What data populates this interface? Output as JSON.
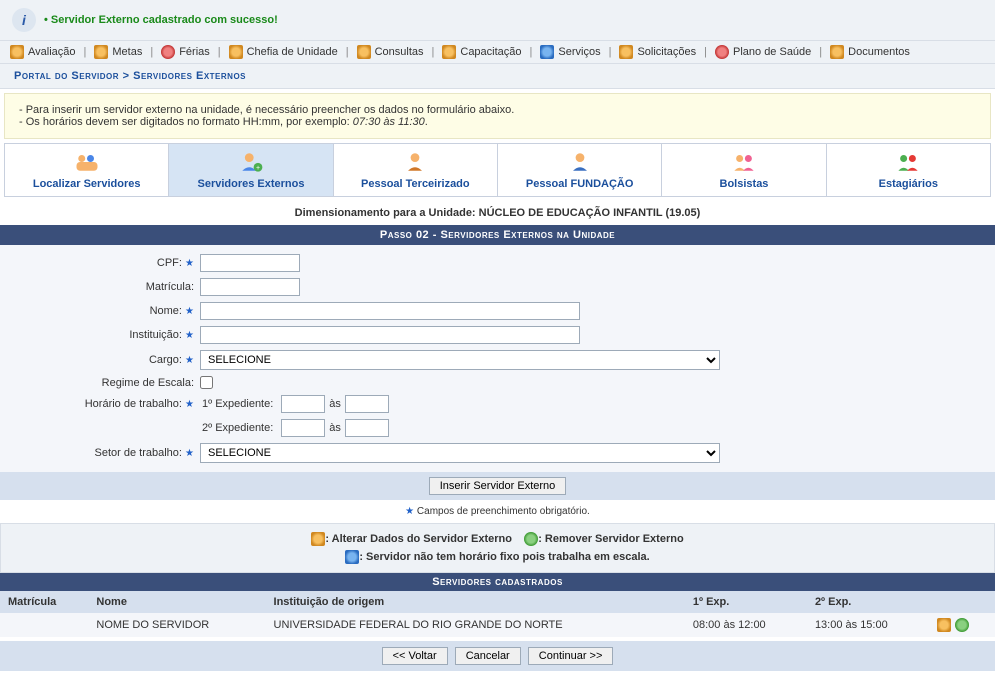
{
  "info": {
    "success_message": "Servidor Externo cadastrado com sucesso!"
  },
  "menu": {
    "items": [
      {
        "label": "Avaliação",
        "icon": "clipboard-icon"
      },
      {
        "label": "Metas",
        "icon": "target-icon"
      },
      {
        "label": "Férias",
        "icon": "sun-icon"
      },
      {
        "label": "Chefia de Unidade",
        "icon": "unit-icon"
      },
      {
        "label": "Consultas",
        "icon": "search-icon"
      },
      {
        "label": "Capacitação",
        "icon": "training-icon"
      },
      {
        "label": "Serviços",
        "icon": "user-icon"
      },
      {
        "label": "Solicitações",
        "icon": "request-icon"
      },
      {
        "label": "Plano de Saúde",
        "icon": "health-icon"
      },
      {
        "label": "Documentos",
        "icon": "documents-icon"
      }
    ]
  },
  "breadcrumb": {
    "portal": "Portal do Servidor",
    "sep": ">",
    "page": "Servidores Externos"
  },
  "tips": {
    "line1": "- Para inserir um servidor externo na unidade, é necessário preencher os dados no formulário abaixo.",
    "line2_a": "- Os horários devem ser digitados no formato HH:mm, por exemplo: ",
    "line2_b": "07:30 às 11:30",
    "line2_c": "."
  },
  "tabs": [
    {
      "label": "Localizar Servidores",
      "active": false
    },
    {
      "label": "Servidores Externos",
      "active": true
    },
    {
      "label": "Pessoal Terceirizado",
      "active": false
    },
    {
      "label": "Pessoal FUNDAÇÃO",
      "active": false
    },
    {
      "label": "Bolsistas",
      "active": false
    },
    {
      "label": "Estagiários",
      "active": false
    }
  ],
  "dimension": {
    "prefix": "Dimensionamento para a Unidade: ",
    "unit": "NÚCLEO DE EDUCAÇÃO INFANTIL (19.05)"
  },
  "section": {
    "title": "Passo 02 - Servidores Externos na Unidade"
  },
  "form": {
    "cpf_label": "CPF:",
    "matricula_label": "Matrícula:",
    "nome_label": "Nome:",
    "instituicao_label": "Instituição:",
    "cargo_label": "Cargo:",
    "cargo_selected": "SELECIONE",
    "regime_label": "Regime de Escala:",
    "horario_label": "Horário de trabalho:",
    "exp1_label": "1º Expediente:",
    "exp2_label": "2º Expediente:",
    "as_label": "às",
    "setor_label": "Setor de trabalho:",
    "setor_selected": "SELECIONE",
    "submit_label": "Inserir Servidor Externo",
    "required_note": "Campos de preenchimento obrigatório."
  },
  "legend": {
    "edit": ": Alterar Dados do Servidor Externo",
    "remove": ": Remover Servidor Externo",
    "scale": ": Servidor não tem horário fixo pois trabalha em escala."
  },
  "registered": {
    "title": "Servidores cadastrados"
  },
  "table": {
    "headers": {
      "matricula": "Matrícula",
      "nome": "Nome",
      "instituicao": "Instituição de origem",
      "exp1": "1º Exp.",
      "exp2": "2º Exp."
    },
    "rows": [
      {
        "matricula": "",
        "nome": "NOME DO SERVIDOR",
        "instituicao": "UNIVERSIDADE FEDERAL DO RIO GRANDE DO NORTE",
        "exp1": "08:00 às 12:00",
        "exp2": "13:00 às 15:00"
      }
    ]
  },
  "nav": {
    "back": "<< Voltar",
    "cancel": "Cancelar",
    "next": "Continuar >>"
  }
}
